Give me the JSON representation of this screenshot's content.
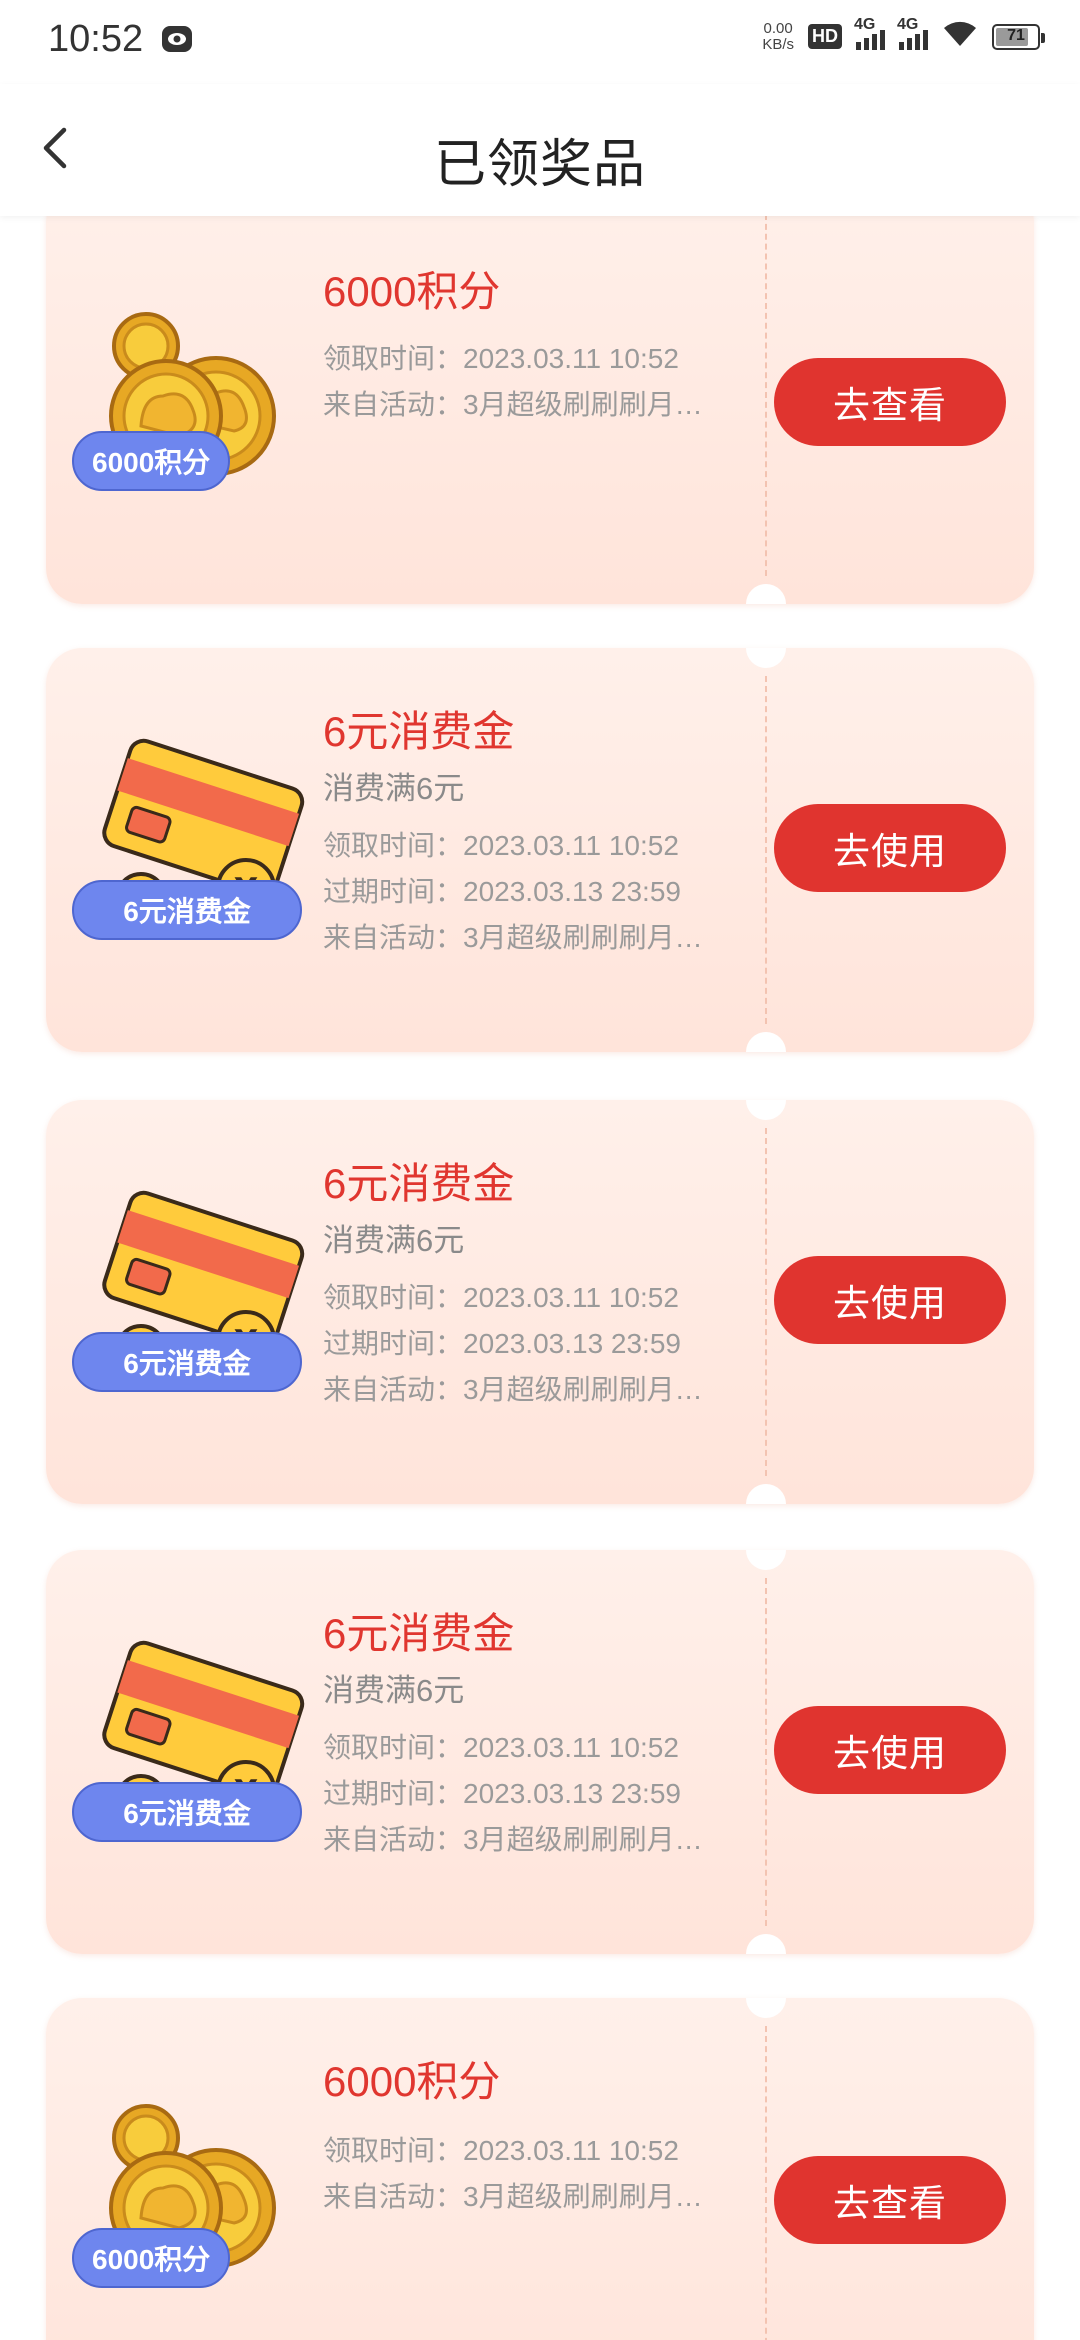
{
  "status_bar": {
    "time": "10:52",
    "net_speed_value": "0.00",
    "net_speed_unit": "KB/s",
    "hd_label": "HD",
    "signal1_label": "4G",
    "signal2_label": "4G",
    "battery": "71"
  },
  "header": {
    "title": "已领奖品",
    "back_icon": "chevron-left-icon"
  },
  "prizes": [
    {
      "type": "points",
      "image_icon": "gold-coins-icon",
      "badge": "6000积分",
      "title": "6000积分",
      "lines": [
        "领取时间：2023.03.11 10:52",
        "来自活动：3月超级刷刷刷月…"
      ],
      "button": "去查看"
    },
    {
      "type": "voucher",
      "image_icon": "bank-card-coins-icon",
      "badge": "6元消费金",
      "title": "6元消费金",
      "subtitle": "消费满6元",
      "lines": [
        "领取时间：2023.03.11 10:52",
        "过期时间：2023.03.13 23:59",
        "来自活动：3月超级刷刷刷月…"
      ],
      "button": "去使用"
    },
    {
      "type": "voucher",
      "image_icon": "bank-card-coins-icon",
      "badge": "6元消费金",
      "title": "6元消费金",
      "subtitle": "消费满6元",
      "lines": [
        "领取时间：2023.03.11 10:52",
        "过期时间：2023.03.13 23:59",
        "来自活动：3月超级刷刷刷月…"
      ],
      "button": "去使用"
    },
    {
      "type": "voucher",
      "image_icon": "bank-card-coins-icon",
      "badge": "6元消费金",
      "title": "6元消费金",
      "subtitle": "消费满6元",
      "lines": [
        "领取时间：2023.03.11 10:52",
        "过期时间：2023.03.13 23:59",
        "来自活动：3月超级刷刷刷月…"
      ],
      "button": "去使用"
    },
    {
      "type": "points",
      "image_icon": "gold-coins-icon",
      "badge": "6000积分",
      "title": "6000积分",
      "lines": [
        "领取时间：2023.03.11 10:52",
        "来自活动：3月超级刷刷刷月…"
      ],
      "button": "去查看"
    }
  ],
  "colors": {
    "accent": "#e0342f",
    "badge": "#6e86ee",
    "card_bg": "#ffeae2"
  }
}
